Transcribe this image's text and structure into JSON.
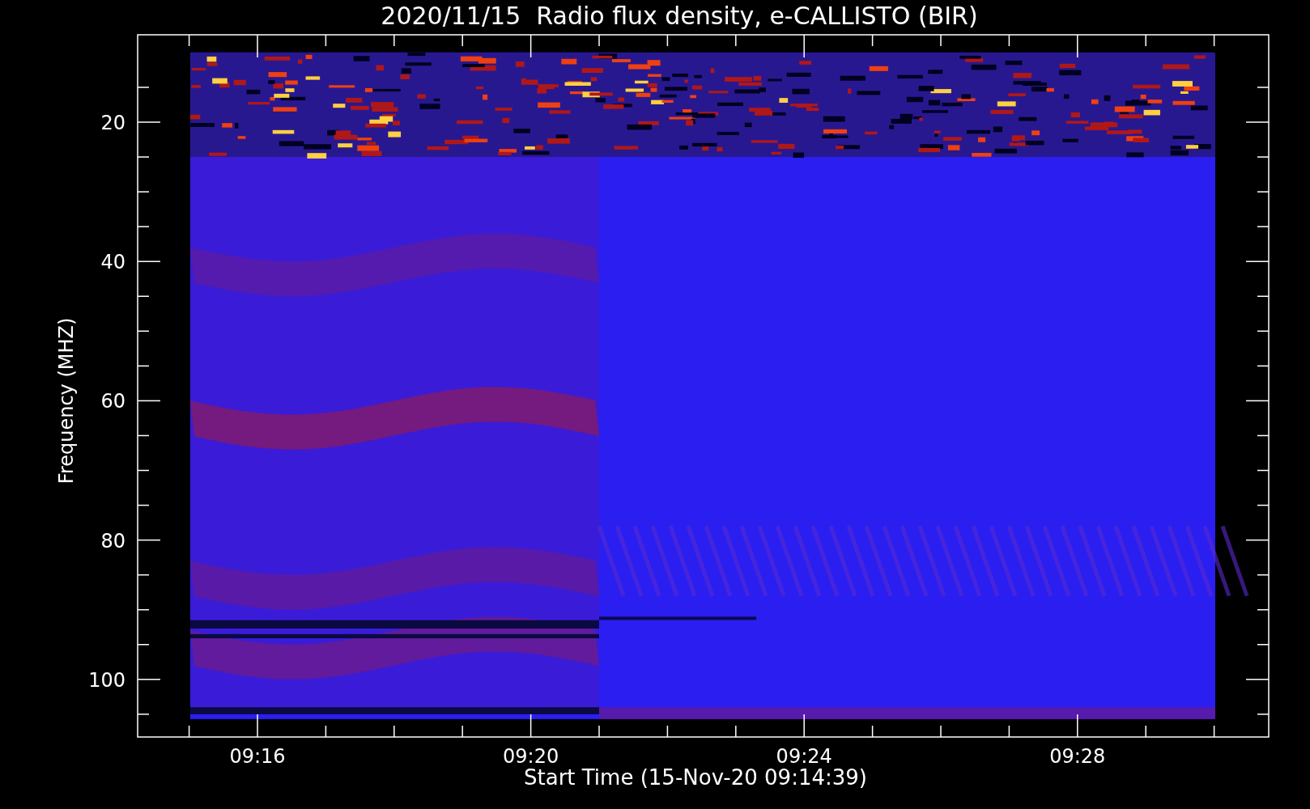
{
  "title": "2020/11/15  Radio flux density, e-CALLISTO (BIR)",
  "plot": {
    "ylabel": "Frequency (MHZ)",
    "y_tick_labels": [
      "20",
      "40",
      "60",
      "80",
      "100"
    ],
    "x_tick_labels": [
      "09:16",
      "09:20",
      "09:24",
      "09:28"
    ],
    "xlabel": "Start Time (15-Nov-20 09:14:39)"
  }
}
